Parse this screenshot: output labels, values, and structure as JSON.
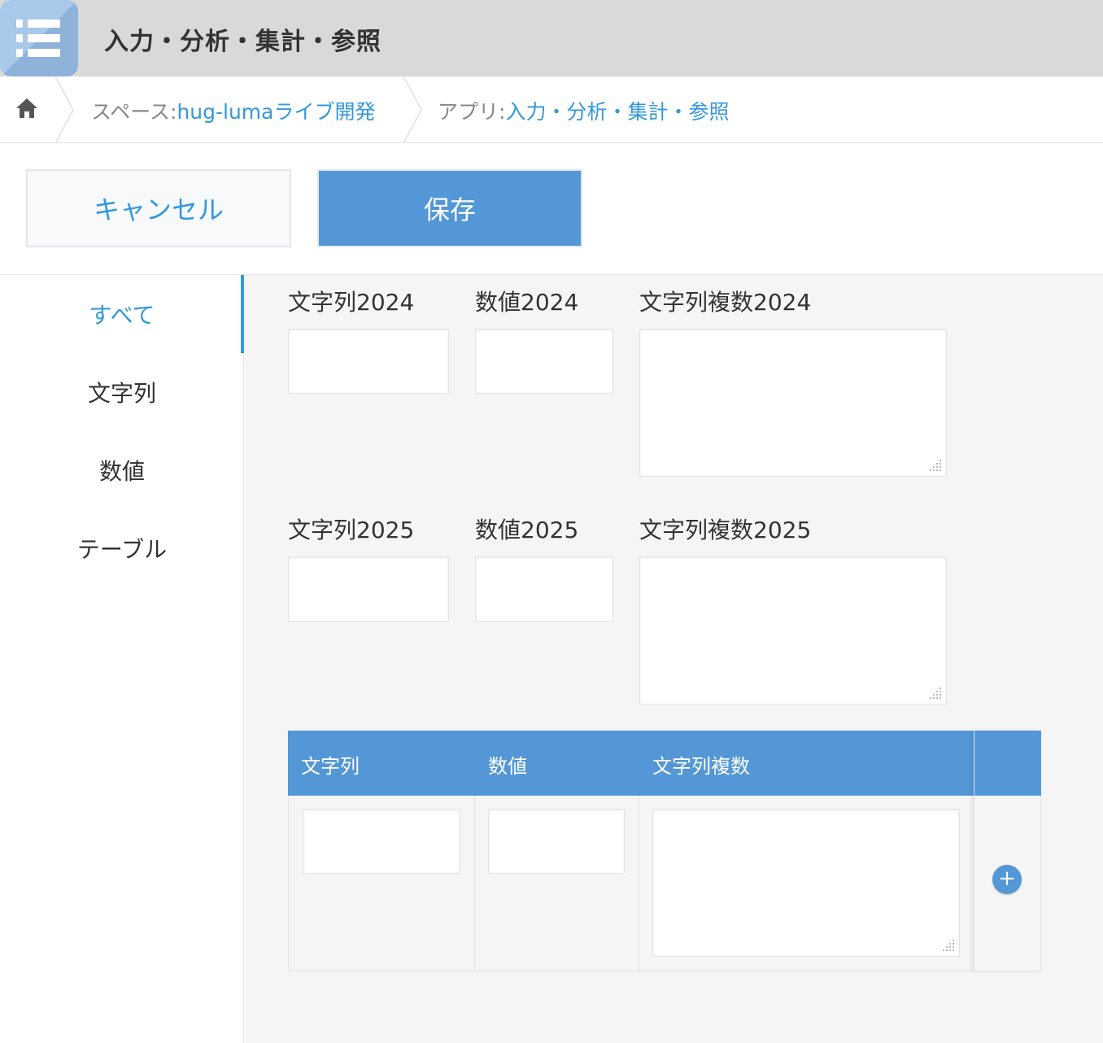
{
  "app": {
    "title": "入力・分析・集計・参照",
    "icon": "list-app-icon"
  },
  "breadcrumb": {
    "home_icon": "home-icon",
    "space_prefix": "スペース:",
    "space_name": "hug-lumaライブ開発",
    "app_prefix": "アプリ:",
    "app_name": "入力・分析・集計・参照"
  },
  "toolbar": {
    "cancel_label": "キャンセル",
    "save_label": "保存"
  },
  "sidebar": {
    "items": [
      {
        "label": "すべて",
        "active": true
      },
      {
        "label": "文字列",
        "active": false
      },
      {
        "label": "数値",
        "active": false
      },
      {
        "label": "テーブル",
        "active": false
      }
    ]
  },
  "fields": {
    "row1": {
      "text": "文字列2024",
      "number": "数値2024",
      "multiline": "文字列複数2024"
    },
    "row2": {
      "text": "文字列2025",
      "number": "数値2025",
      "multiline": "文字列複数2025"
    }
  },
  "table": {
    "headers": [
      "文字列",
      "数値",
      "文字列複数"
    ],
    "add_icon": "plus-circle-icon",
    "add_symbol": "+"
  },
  "colors": {
    "accent": "#3498db",
    "header_bg": "#5397d6",
    "app_header_bg": "#d8d9d8",
    "content_bg": "#f5f5f5"
  }
}
